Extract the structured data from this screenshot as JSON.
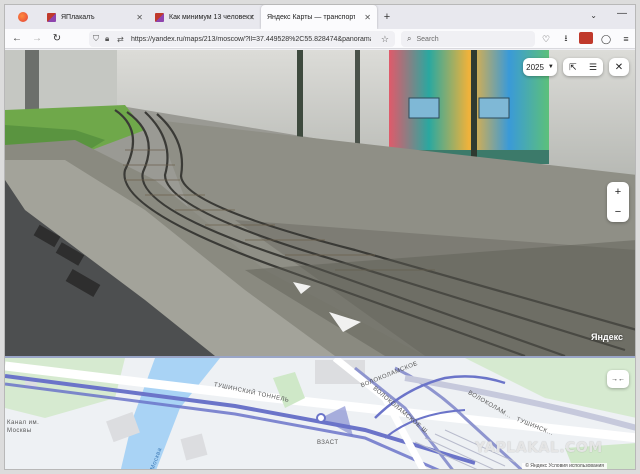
{
  "browser": {
    "tabs": [
      {
        "label": "ЯПлакалъ"
      },
      {
        "label": "Как минимум 13 человек постр"
      },
      {
        "label": "Яндекс Карты — транспорт, на"
      }
    ],
    "new_tab": "+",
    "tabs_menu": "⌄",
    "minimize": "—",
    "url": "https://yandex.ru/maps/213/moscow/?ll=37.449528%2C55.828474&panorama%5Bdirectio",
    "search_placeholder": "Search"
  },
  "panorama": {
    "year": "2025",
    "brand": "Яндекс",
    "zoom_in": "+",
    "zoom_out": "−",
    "close": "✕"
  },
  "map": {
    "labels": {
      "tunnel": "ТУШИНСКИЙ ТОННЕЛЬ",
      "volok1": "ВОЛОКОЛАМСКОЕ",
      "volok2": "ВОЛОКОЛАМСКОЕ Ш.",
      "volok3": "ВОЛОКОЛАМ...",
      "tush": "ТУШИНСК...",
      "kanal1": "Канал им.",
      "kanal2": "Москвы",
      "moskva": "Москва",
      "bus": "ВЗАСТ"
    },
    "footer": "© Яндекс  Условия использования",
    "watermark": "YAPLAKAL.COM"
  },
  "colors": {
    "water": "#a9d3f5",
    "tunnel_blue": "#6b74c9",
    "park": "#cfe8c8"
  }
}
